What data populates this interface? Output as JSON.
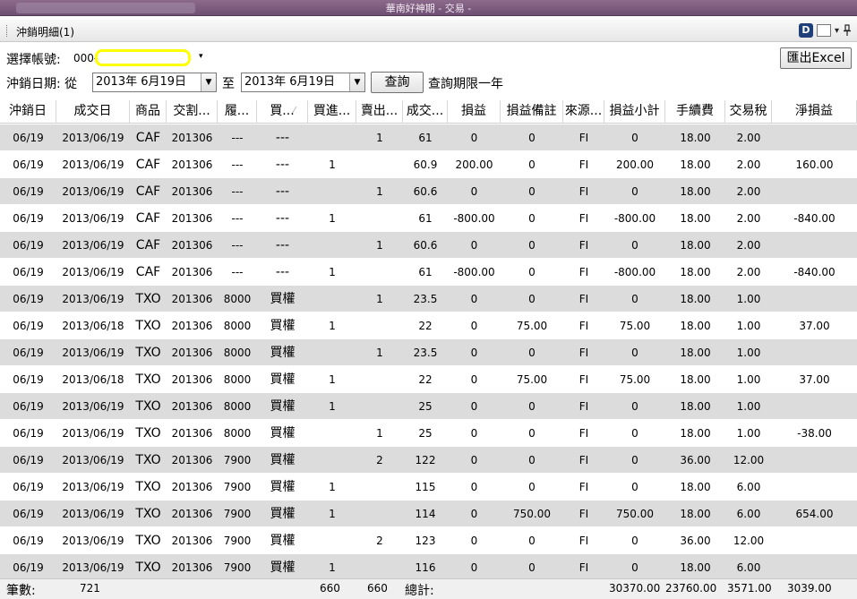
{
  "window": {
    "title": "華南好神期 - 交易 -"
  },
  "panel": {
    "title": "沖銷明細(1)",
    "d_icon": "D",
    "pin_icon": "pin-icon",
    "dropdown_icon": "▾"
  },
  "form": {
    "account_label": "選擇帳號:",
    "account_value": "000-",
    "export_button": "匯出Excel",
    "date_label": "沖銷日期: 從",
    "date_from": "2013年  6月19日",
    "to_label": "至",
    "date_to": "2013年  6月19日",
    "query_button": "查詢",
    "query_limit_text": "查詢期限一年"
  },
  "table": {
    "columns": [
      "沖銷日",
      "成交日",
      "商品",
      "交割...",
      "履...",
      "買...",
      "買進...",
      "賣出...",
      "成交...",
      "損益",
      "損益備註",
      "來源...",
      "損益小計",
      "手續費",
      "交易稅",
      "淨損益"
    ],
    "sort_marker": "⁄",
    "rows": [
      [
        "06/19",
        "2013/06/19",
        "CAF",
        "201306",
        "---",
        "---",
        "",
        "1",
        "61",
        "0",
        "0",
        "FI",
        "0",
        "18.00",
        "2.00",
        ""
      ],
      [
        "06/19",
        "2013/06/19",
        "CAF",
        "201306",
        "---",
        "---",
        "1",
        "",
        "60.9",
        "200.00",
        "0",
        "FI",
        "200.00",
        "18.00",
        "2.00",
        "160.00"
      ],
      [
        "06/19",
        "2013/06/19",
        "CAF",
        "201306",
        "---",
        "---",
        "",
        "1",
        "60.6",
        "0",
        "0",
        "FI",
        "0",
        "18.00",
        "2.00",
        ""
      ],
      [
        "06/19",
        "2013/06/19",
        "CAF",
        "201306",
        "---",
        "---",
        "1",
        "",
        "61",
        "-800.00",
        "0",
        "FI",
        "-800.00",
        "18.00",
        "2.00",
        "-840.00"
      ],
      [
        "06/19",
        "2013/06/19",
        "CAF",
        "201306",
        "---",
        "---",
        "",
        "1",
        "60.6",
        "0",
        "0",
        "FI",
        "0",
        "18.00",
        "2.00",
        ""
      ],
      [
        "06/19",
        "2013/06/19",
        "CAF",
        "201306",
        "---",
        "---",
        "1",
        "",
        "61",
        "-800.00",
        "0",
        "FI",
        "-800.00",
        "18.00",
        "2.00",
        "-840.00"
      ],
      [
        "06/19",
        "2013/06/19",
        "TXO",
        "201306",
        "8000",
        "買權",
        "",
        "1",
        "23.5",
        "0",
        "0",
        "FI",
        "0",
        "18.00",
        "1.00",
        ""
      ],
      [
        "06/19",
        "2013/06/18",
        "TXO",
        "201306",
        "8000",
        "買權",
        "1",
        "",
        "22",
        "0",
        "75.00",
        "FI",
        "75.00",
        "18.00",
        "1.00",
        "37.00"
      ],
      [
        "06/19",
        "2013/06/19",
        "TXO",
        "201306",
        "8000",
        "買權",
        "",
        "1",
        "23.5",
        "0",
        "0",
        "FI",
        "0",
        "18.00",
        "1.00",
        ""
      ],
      [
        "06/19",
        "2013/06/18",
        "TXO",
        "201306",
        "8000",
        "買權",
        "1",
        "",
        "22",
        "0",
        "75.00",
        "FI",
        "75.00",
        "18.00",
        "1.00",
        "37.00"
      ],
      [
        "06/19",
        "2013/06/19",
        "TXO",
        "201306",
        "8000",
        "買權",
        "1",
        "",
        "25",
        "0",
        "0",
        "FI",
        "0",
        "18.00",
        "1.00",
        ""
      ],
      [
        "06/19",
        "2013/06/19",
        "TXO",
        "201306",
        "8000",
        "買權",
        "",
        "1",
        "25",
        "0",
        "0",
        "FI",
        "0",
        "18.00",
        "1.00",
        "-38.00"
      ],
      [
        "06/19",
        "2013/06/19",
        "TXO",
        "201306",
        "7900",
        "買權",
        "",
        "2",
        "122",
        "0",
        "0",
        "FI",
        "0",
        "36.00",
        "12.00",
        ""
      ],
      [
        "06/19",
        "2013/06/19",
        "TXO",
        "201306",
        "7900",
        "買權",
        "1",
        "",
        "115",
        "0",
        "0",
        "FI",
        "0",
        "18.00",
        "6.00",
        ""
      ],
      [
        "06/19",
        "2013/06/19",
        "TXO",
        "201306",
        "7900",
        "買權",
        "1",
        "",
        "114",
        "0",
        "750.00",
        "FI",
        "750.00",
        "18.00",
        "6.00",
        "654.00"
      ],
      [
        "06/19",
        "2013/06/19",
        "TXO",
        "201306",
        "7900",
        "買權",
        "",
        "2",
        "123",
        "0",
        "0",
        "FI",
        "0",
        "36.00",
        "12.00",
        ""
      ],
      [
        "06/19",
        "2013/06/19",
        "TXO",
        "201306",
        "7900",
        "買權",
        "1",
        "",
        "116",
        "0",
        "0",
        "FI",
        "0",
        "18.00",
        "6.00",
        ""
      ]
    ]
  },
  "footer": {
    "count_label": "筆數:",
    "count": "721",
    "buy_total": "660",
    "sell_total": "660",
    "total_label": "總計:",
    "pnl_subtotal": "30370.00",
    "fee_total": "23760.00",
    "tax_total": "3571.00",
    "net_total": "3039.00"
  }
}
